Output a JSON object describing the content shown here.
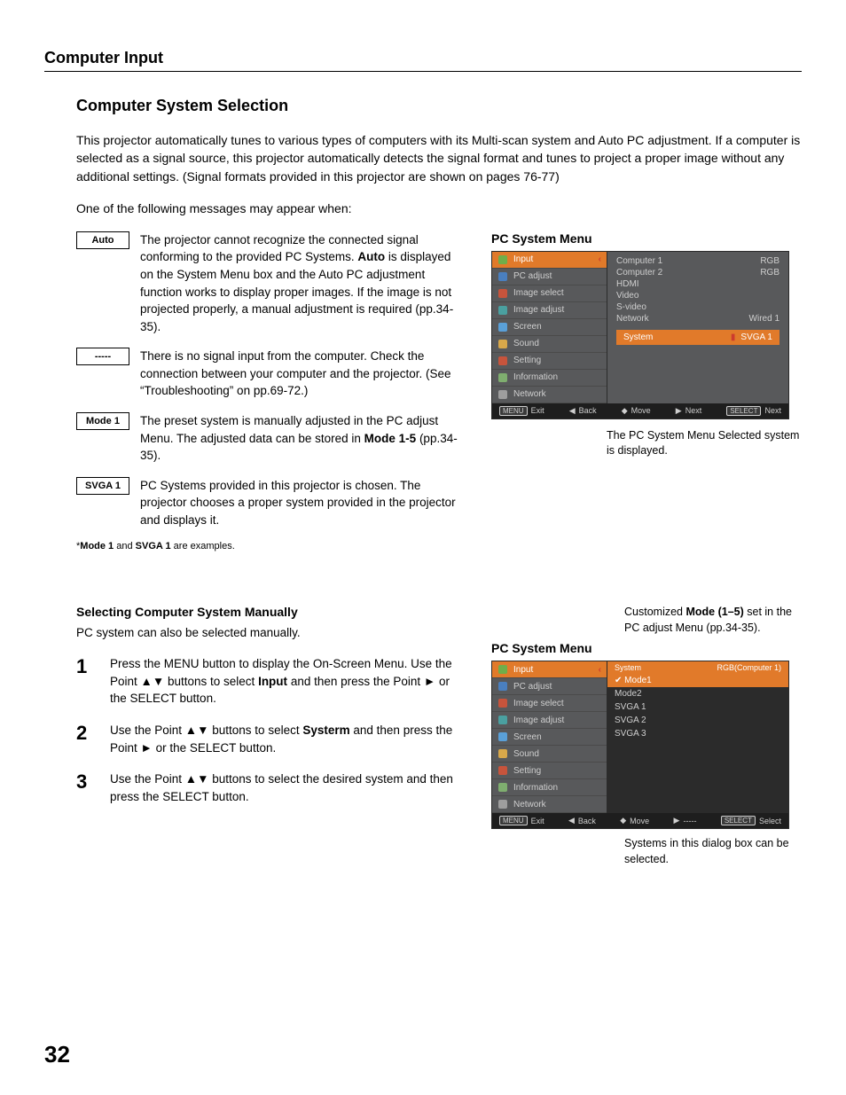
{
  "section": "Computer Input",
  "title": "Computer System Selection",
  "intro": "This projector automatically tunes to various types of computers with its Multi-scan system and Auto PC adjustment. If a computer is selected as a signal source, this projector automatically detects the signal format and tunes to project a proper image without any additional settings. (Signal formats provided in this projector are shown on pages 76-77)",
  "leadin": "One of the following messages may appear when:",
  "defs": [
    {
      "label": "Auto",
      "text": "The projector cannot recognize the connected signal conforming to the provided PC Systems. <b>Auto</b> is displayed on the System Menu box and the Auto PC adjustment function works to display proper images. If the image is not projected properly, a manual adjustment is required (pp.34-35)."
    },
    {
      "label": "-----",
      "text": "There is no signal input from the computer. Check the connection between your computer and the projector. (See “Troubleshooting” on pp.69-72.)"
    },
    {
      "label": "Mode 1",
      "text": "The preset system is manually adjusted in the PC adjust Menu. The adjusted data can be stored in <b>Mode 1-5</b> (pp.34-35)."
    },
    {
      "label": "SVGA 1",
      "text": "PC Systems provided in this projector is chosen. The projector chooses a proper system provided in the projector and displays it."
    }
  ],
  "defs_note": "*<b>Mode 1</b> and <b>SVGA 1</b> are examples.",
  "menu1": {
    "heading": "PC System Menu",
    "left": [
      "Input",
      "PC adjust",
      "Image select",
      "Image adjust",
      "Screen",
      "Sound",
      "Setting",
      "Information",
      "Network"
    ],
    "right": [
      {
        "a": "Computer 1",
        "b": "RGB"
      },
      {
        "a": "Computer 2",
        "b": "RGB"
      },
      {
        "a": "HDMI",
        "b": ""
      },
      {
        "a": "Video",
        "b": ""
      },
      {
        "a": "S-video",
        "b": ""
      },
      {
        "a": "Network",
        "b": "Wired 1"
      }
    ],
    "system_row": {
      "a": "System",
      "b": "SVGA 1"
    },
    "footer": {
      "a": "Exit",
      "b": "Back",
      "c": "Move",
      "d": "Next",
      "e": "Next"
    },
    "caption": "The PC System Menu Selected system is displayed."
  },
  "manual": {
    "heading": "Selecting Computer System Manually",
    "sub": "PC system can also be selected manually.",
    "steps": [
      "Press the MENU button to display the On-Screen Menu. Use the Point ▲▼ buttons to select <b>Input</b> and then press the Point ► or the SELECT button.",
      "Use the Point ▲▼ buttons to select <b>Systerm</b> and then press the Point ► or the SELECT button.",
      "Use the Point ▲▼ buttons to select the desired system and then press the SELECT button."
    ]
  },
  "menu2": {
    "top_caption": "Customized <b>Mode (1–5)</b> set in the PC adjust Menu (pp.34-35).",
    "heading": "PC System Menu",
    "left": [
      "Input",
      "PC adjust",
      "Image select",
      "Image adjust",
      "Screen",
      "Sound",
      "Setting",
      "Information",
      "Network"
    ],
    "head": {
      "a": "System",
      "b": "RGB(Computer 1)"
    },
    "sel": "Mode1",
    "items": [
      "Mode2",
      "SVGA 1",
      "SVGA 2",
      "SVGA 3"
    ],
    "footer": {
      "a": "Exit",
      "b": "Back",
      "c": "Move",
      "d": "-----",
      "e": "Select"
    },
    "caption": "Systems in this dialog box can be selected."
  },
  "page": "32"
}
